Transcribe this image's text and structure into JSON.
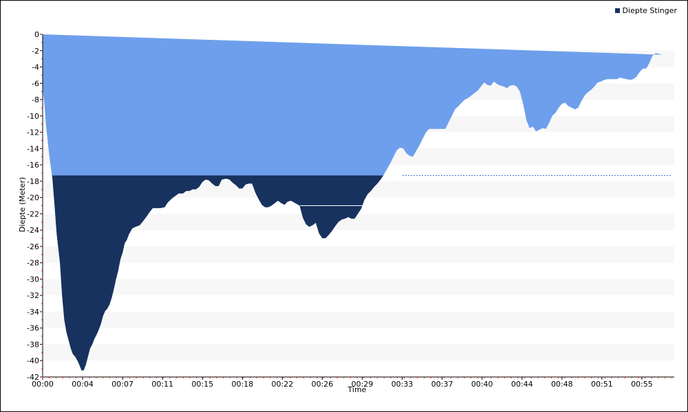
{
  "chart_data": {
    "type": "area",
    "title": "",
    "xlabel": "Time",
    "ylabel": "Diepte (Meter)",
    "x_unit": "minutes",
    "xlim": [
      0,
      58.5
    ],
    "ylim": [
      -42,
      0
    ],
    "y_ticks": [
      0,
      -2,
      -4,
      -6,
      -8,
      -10,
      -12,
      -14,
      -16,
      -18,
      -20,
      -22,
      -24,
      -26,
      -28,
      -30,
      -32,
      -34,
      -36,
      -38,
      -40,
      -42
    ],
    "x_ticks": [
      {
        "value": 0,
        "label": "00:00"
      },
      {
        "value": 3.7,
        "label": "00:04"
      },
      {
        "value": 7.4,
        "label": "00:07"
      },
      {
        "value": 11.1,
        "label": "00:11"
      },
      {
        "value": 14.8,
        "label": "00:15"
      },
      {
        "value": 18.5,
        "label": "00:18"
      },
      {
        "value": 22.2,
        "label": "00:22"
      },
      {
        "value": 25.9,
        "label": "00:26"
      },
      {
        "value": 29.6,
        "label": "00:29"
      },
      {
        "value": 33.3,
        "label": "00:33"
      },
      {
        "value": 37.0,
        "label": "00:37"
      },
      {
        "value": 40.7,
        "label": "00:40"
      },
      {
        "value": 44.4,
        "label": "00:44"
      },
      {
        "value": 48.1,
        "label": "00:48"
      },
      {
        "value": 51.8,
        "label": "00:51"
      },
      {
        "value": 55.5,
        "label": "00:55"
      }
    ],
    "threshold_depth": -17.3,
    "series": [
      {
        "name": "Diepte Stinger",
        "color": "#17325f",
        "x": [
          0,
          0.15,
          0.3,
          0.5,
          0.7,
          0.9,
          1.1,
          1.3,
          1.6,
          1.8,
          2.0,
          2.2,
          2.4,
          2.6,
          2.8,
          3.0,
          3.3,
          3.6,
          3.8,
          4.0,
          4.2,
          4.4,
          4.6,
          4.8,
          5.0,
          5.2,
          5.4,
          5.6,
          5.8,
          6.0,
          6.2,
          6.4,
          6.6,
          6.8,
          7.0,
          7.2,
          7.4,
          7.6,
          7.8,
          8.0,
          8.3,
          8.6,
          9.0,
          9.3,
          9.6,
          9.9,
          10.2,
          10.5,
          10.9,
          11.3,
          11.6,
          12.0,
          12.3,
          12.6,
          13.0,
          13.3,
          13.6,
          13.9,
          14.2,
          14.5,
          14.8,
          15.1,
          15.4,
          15.7,
          16.0,
          16.3,
          16.6,
          17.0,
          17.3,
          17.6,
          17.9,
          18.2,
          18.5,
          18.8,
          19.1,
          19.4,
          19.7,
          20.0,
          20.3,
          20.6,
          20.9,
          21.2,
          21.5,
          21.8,
          22.1,
          22.4,
          22.7,
          23.0,
          23.4,
          23.8,
          24.1,
          24.4,
          24.7,
          25.0,
          25.3,
          25.6,
          25.9,
          26.2,
          26.5,
          26.8,
          27.1,
          27.4,
          27.7,
          28.0,
          28.3,
          28.6,
          28.9,
          29.2,
          29.5,
          29.8,
          30.1,
          30.4,
          30.7,
          31.0,
          31.3,
          31.6,
          31.9,
          32.2,
          32.5,
          32.8,
          33.1,
          33.4,
          33.7,
          34.0,
          34.3,
          34.6,
          34.9,
          35.2,
          35.5,
          35.8,
          36.1,
          36.4,
          36.7,
          37.0,
          37.3,
          37.6,
          37.9,
          38.2,
          38.5,
          38.8,
          39.1,
          39.4,
          39.7,
          40.0,
          40.3,
          40.6,
          40.9,
          41.2,
          41.5,
          41.8,
          42.1,
          42.4,
          42.7,
          43.0,
          43.3,
          43.6,
          43.9,
          44.2,
          44.5,
          44.8,
          45.1,
          45.4,
          45.7,
          46.0,
          46.3,
          46.6,
          46.9,
          47.2,
          47.5,
          47.8,
          48.1,
          48.4,
          48.7,
          49.0,
          49.3,
          49.6,
          49.9,
          50.2,
          50.5,
          50.8,
          51.1,
          51.4,
          51.7,
          52.0,
          52.3,
          52.6,
          52.9,
          53.2,
          53.5,
          53.8,
          54.1,
          54.4,
          54.7,
          55.0,
          55.3,
          55.6,
          55.9,
          56.2,
          56.5,
          56.8,
          57.1,
          57.4,
          57.7,
          58.0,
          58.3
        ],
        "depth": [
          -6.5,
          -8.5,
          -11,
          -13.5,
          -15.8,
          -17.6,
          -21,
          -24.5,
          -28,
          -32,
          -35,
          -36.5,
          -37.5,
          -38.5,
          -39.2,
          -39.5,
          -40.2,
          -41.2,
          -41.2,
          -40.5,
          -39.5,
          -38.5,
          -38.0,
          -37.3,
          -36.8,
          -36.2,
          -35.5,
          -34.5,
          -33.9,
          -33.6,
          -33.1,
          -32.3,
          -31.2,
          -30.0,
          -29.0,
          -27.6,
          -26.8,
          -25.6,
          -25.2,
          -24.5,
          -23.8,
          -23.6,
          -23.4,
          -22.9,
          -22.4,
          -21.8,
          -21.3,
          -21.3,
          -21.3,
          -21.2,
          -20.6,
          -20.1,
          -19.8,
          -19.5,
          -19.5,
          -19.2,
          -19.2,
          -19.0,
          -19.0,
          -18.7,
          -18.1,
          -17.8,
          -17.9,
          -18.3,
          -18.6,
          -18.6,
          -17.8,
          -17.7,
          -17.8,
          -18.2,
          -18.5,
          -18.9,
          -18.9,
          -18.4,
          -18.3,
          -18.3,
          -19.4,
          -20.2,
          -20.9,
          -21.2,
          -21.2,
          -21.0,
          -20.7,
          -20.4,
          -20.7,
          -20.9,
          -20.5,
          -20.4,
          -20.7,
          -21.0,
          -22.5,
          -23.3,
          -23.6,
          -23.4,
          -23.1,
          -24.4,
          -25.0,
          -25.0,
          -24.6,
          -24.1,
          -23.5,
          -23.0,
          -22.7,
          -22.6,
          -22.4,
          -22.6,
          -22.6,
          -22.0,
          -21.4,
          -20.3,
          -19.6,
          -19.2,
          -18.7,
          -18.3,
          -17.8,
          -17.2,
          -16.5,
          -15.8,
          -15.0,
          -14.2,
          -13.9,
          -14.0,
          -14.6,
          -14.9,
          -15.0,
          -14.3,
          -13.6,
          -12.8,
          -12.0,
          -11.6,
          -11.6,
          -11.6,
          -11.6,
          -11.6,
          -11.6,
          -10.8,
          -10.0,
          -9.2,
          -8.8,
          -8.4,
          -8.0,
          -7.8,
          -7.5,
          -7.2,
          -6.9,
          -6.4,
          -5.9,
          -6.2,
          -6.3,
          -5.8,
          -6.1,
          -6.3,
          -6.4,
          -6.6,
          -6.3,
          -6.2,
          -6.4,
          -7.0,
          -8.5,
          -10.5,
          -11.5,
          -11.3,
          -11.9,
          -11.7,
          -11.5,
          -11.6,
          -10.9,
          -10.0,
          -9.6,
          -9.0,
          -8.5,
          -8.4,
          -8.8,
          -9.0,
          -9.2,
          -9.0,
          -8.2,
          -7.5,
          -7.1,
          -6.8,
          -6.4,
          -5.9,
          -5.8,
          -5.6,
          -5.5,
          -5.5,
          -5.5,
          -5.5,
          -5.3,
          -5.4,
          -5.5,
          -5.6,
          -5.5,
          -5.2,
          -4.6,
          -4.2,
          -4.2,
          -3.5,
          -2.6,
          -2.3,
          -2.4,
          -2.5
        ]
      }
    ],
    "legend": {
      "position": "top-right",
      "entries": [
        "Diepte Stinger"
      ]
    },
    "grid": "horizontal-bands"
  },
  "colors": {
    "above_threshold": "#6e9fec",
    "below_threshold": "#17325f",
    "band": "#f7f7f7",
    "threshold_line": "#4468d0",
    "axis": "#000000",
    "tick_marker": "#ff0000"
  }
}
